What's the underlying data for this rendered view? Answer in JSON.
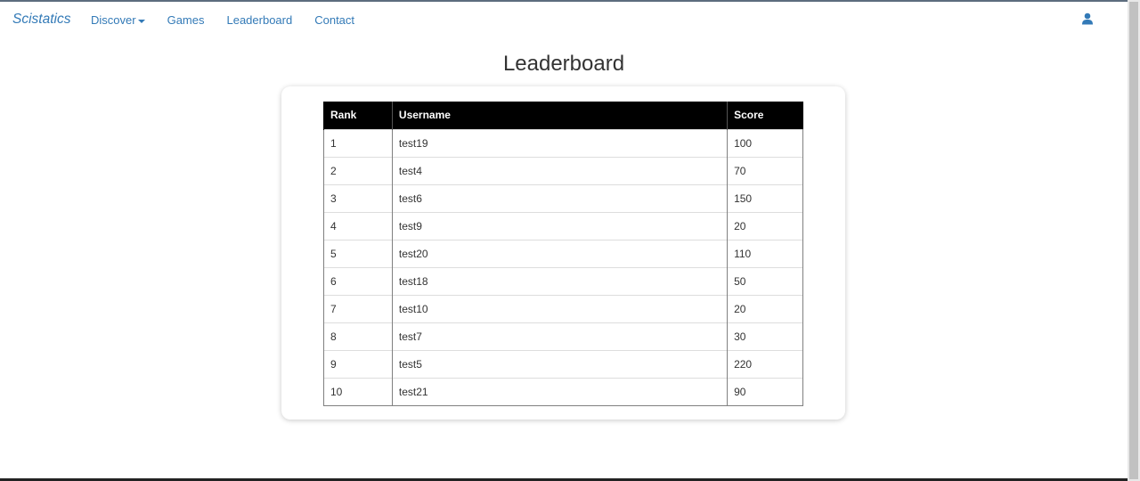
{
  "navbar": {
    "brand": "Scistatics",
    "links": [
      {
        "label": "Discover",
        "has_caret": true
      },
      {
        "label": "Games"
      },
      {
        "label": "Leaderboard"
      },
      {
        "label": "Contact"
      }
    ],
    "user_icon": "user-icon"
  },
  "page": {
    "title": "Leaderboard"
  },
  "table": {
    "headers": [
      "Rank",
      "Username",
      "Score"
    ],
    "rows": [
      {
        "rank": "1",
        "username": "test19",
        "score": "100"
      },
      {
        "rank": "2",
        "username": "test4",
        "score": "70"
      },
      {
        "rank": "3",
        "username": "test6",
        "score": "150"
      },
      {
        "rank": "4",
        "username": "test9",
        "score": "20"
      },
      {
        "rank": "5",
        "username": "test20",
        "score": "110"
      },
      {
        "rank": "6",
        "username": "test18",
        "score": "50"
      },
      {
        "rank": "7",
        "username": "test10",
        "score": "20"
      },
      {
        "rank": "8",
        "username": "test7",
        "score": "30"
      },
      {
        "rank": "9",
        "username": "test5",
        "score": "220"
      },
      {
        "rank": "10",
        "username": "test21",
        "score": "90"
      }
    ]
  },
  "colors": {
    "link": "#337ab7",
    "header_bg": "#000000",
    "header_text": "#ffffff"
  }
}
